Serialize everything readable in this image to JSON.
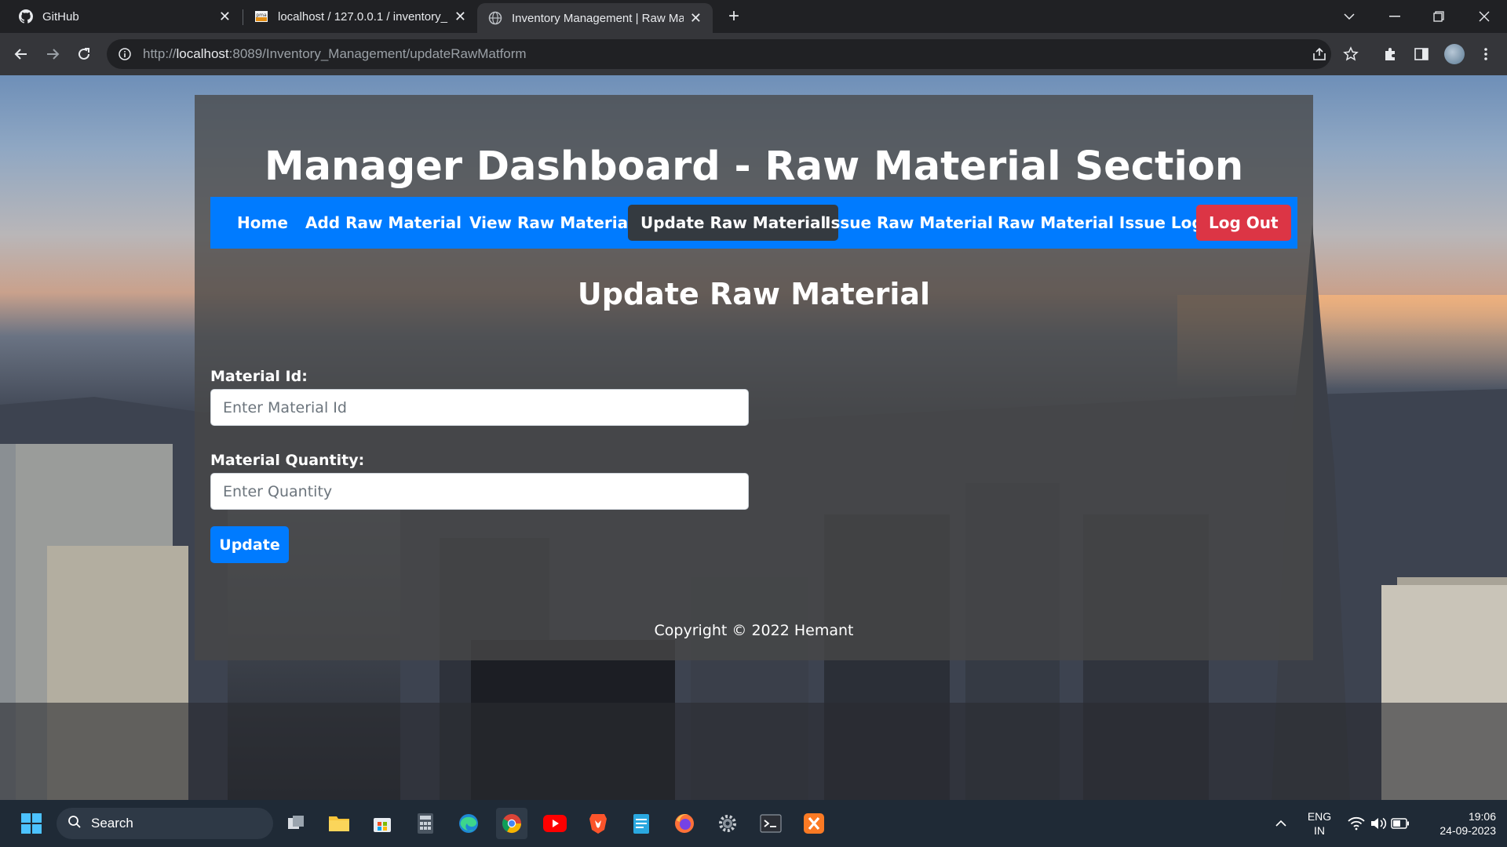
{
  "browser": {
    "tabs": [
      {
        "title": "GitHub",
        "icon": "github-icon",
        "close": "✕"
      },
      {
        "title": "localhost / 127.0.0.1 / inventory_",
        "icon": "phpmyadmin-icon",
        "close": "✕"
      },
      {
        "title": "Inventory Management | Raw Ma",
        "icon": "globe-icon",
        "close": "✕",
        "active": true
      }
    ],
    "new_tab": "+",
    "url_prefix": "http://",
    "url_host": "localhost",
    "url_rest": ":8089/Inventory_Management/updateRawMatform"
  },
  "page": {
    "title": "Manager Dashboard - Raw Material Section",
    "nav": [
      {
        "label": "Home"
      },
      {
        "label": "Add Raw Material"
      },
      {
        "label": "View Raw Material"
      },
      {
        "label": "Update Raw Material",
        "active": true
      },
      {
        "label": "Issue Raw Material"
      },
      {
        "label": "Raw Material Issue Log"
      },
      {
        "label": "Log Out"
      }
    ],
    "section_title": "Update Raw Material",
    "form": {
      "material_id_label": "Material Id:",
      "material_id_placeholder": "Enter Material Id",
      "material_id_value": "",
      "quantity_label": "Material Quantity:",
      "quantity_placeholder": "Enter Quantity",
      "quantity_value": "",
      "submit_label": "Update"
    },
    "footer": "Copyright © 2022 Hemant"
  },
  "taskbar": {
    "search_label": "Search",
    "language_line1": "ENG",
    "language_line2": "IN",
    "time": "19:06",
    "date": "24-09-2023"
  },
  "colors": {
    "primary": "#007bff",
    "active_nav": "#343a40",
    "danger": "#dc3545"
  }
}
